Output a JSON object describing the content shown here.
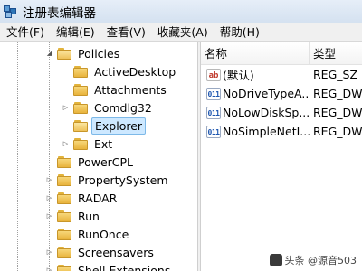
{
  "window": {
    "title": "注册表编辑器"
  },
  "menu": [
    {
      "label": "文件(F)"
    },
    {
      "label": "编辑(E)"
    },
    {
      "label": "查看(V)"
    },
    {
      "label": "收藏夹(A)"
    },
    {
      "label": "帮助(H)"
    }
  ],
  "tree": {
    "nodes": [
      {
        "label": "Policies",
        "expander": "open",
        "selected": false
      },
      {
        "label": "ActiveDesktop",
        "expander": "none",
        "selected": false
      },
      {
        "label": "Attachments",
        "expander": "none",
        "selected": false
      },
      {
        "label": "Comdlg32",
        "expander": "closed",
        "selected": false
      },
      {
        "label": "Explorer",
        "expander": "none",
        "selected": true
      },
      {
        "label": "Ext",
        "expander": "closed",
        "selected": false
      },
      {
        "label": "PowerCPL",
        "expander": "none",
        "selected": false
      },
      {
        "label": "PropertySystem",
        "expander": "closed",
        "selected": false
      },
      {
        "label": "RADAR",
        "expander": "closed",
        "selected": false
      },
      {
        "label": "Run",
        "expander": "closed",
        "selected": false
      },
      {
        "label": "RunOnce",
        "expander": "none",
        "selected": false
      },
      {
        "label": "Screensavers",
        "expander": "closed",
        "selected": false
      },
      {
        "label": "Shell Extensions",
        "expander": "closed",
        "selected": false
      }
    ]
  },
  "values": {
    "headers": {
      "name": "名称",
      "type": "类型"
    },
    "rows": [
      {
        "icon": "string-value-icon",
        "name": "(默认)",
        "type": "REG_SZ"
      },
      {
        "icon": "dword-value-icon",
        "name": "NoDriveTypeA...",
        "type": "REG_DWO"
      },
      {
        "icon": "dword-value-icon",
        "name": "NoLowDiskSp...",
        "type": "REG_DWO"
      },
      {
        "icon": "dword-value-icon",
        "name": "NoSimpleNetI...",
        "type": "REG_DWO"
      }
    ],
    "icon_text": {
      "sz": "ab",
      "dword": "011"
    }
  },
  "watermark": {
    "text": "头条 @源音503"
  },
  "colors": {
    "selection": "#cde8ff",
    "selection_border": "#7db9e8",
    "folder": "#e8b33c"
  }
}
